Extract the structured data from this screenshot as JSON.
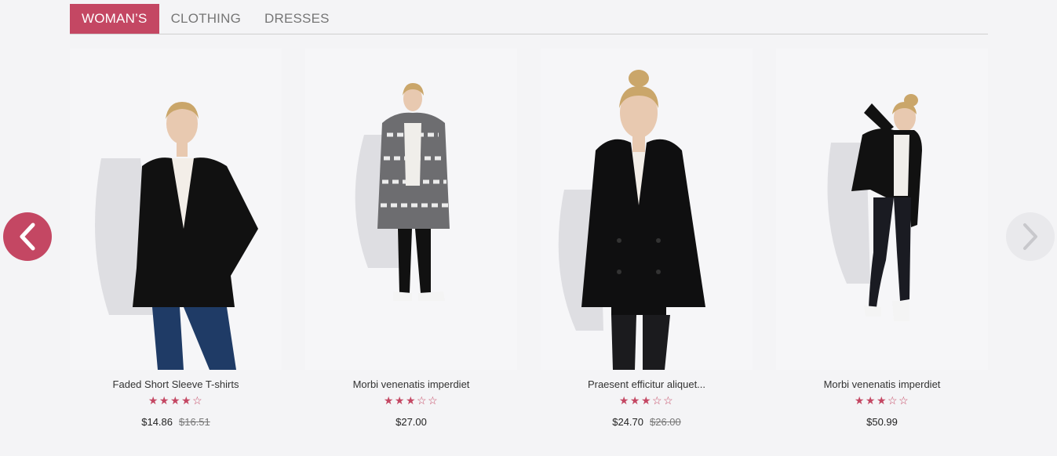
{
  "tabs": [
    {
      "label": "WOMAN’S",
      "active": true
    },
    {
      "label": "CLOTHING",
      "active": false
    },
    {
      "label": "DRESSES",
      "active": false
    }
  ],
  "colors": {
    "accent": "#c44763",
    "background": "#f4f4f6"
  },
  "nav": {
    "prev_icon": "chevron-left-icon",
    "next_icon": "chevron-right-icon"
  },
  "products": [
    {
      "name": "Faded Short Sleeve T-shirts",
      "stars_filled": 4,
      "stars_total": 5,
      "stars": "★★★★☆",
      "price": "$14.86",
      "old_price": "$16.51"
    },
    {
      "name": "Morbi venenatis imperdiet",
      "stars_filled": 3,
      "stars_total": 5,
      "stars": "★★★☆☆",
      "price": "$27.00",
      "old_price": ""
    },
    {
      "name": "Praesent efficitur aliquet...",
      "stars_filled": 3,
      "stars_total": 5,
      "stars": "★★★☆☆",
      "price": "$24.70",
      "old_price": "$26.00"
    },
    {
      "name": "Morbi venenatis imperdiet",
      "stars_filled": 3,
      "stars_total": 5,
      "stars": "★★★☆☆",
      "price": "$50.99",
      "old_price": ""
    }
  ]
}
